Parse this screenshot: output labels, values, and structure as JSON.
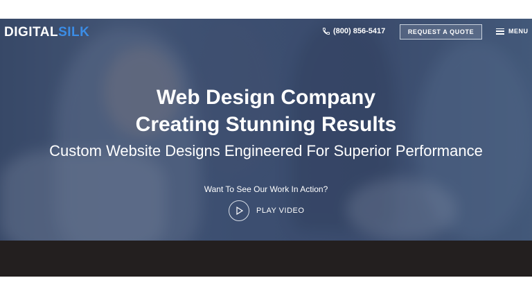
{
  "header": {
    "logo_part1": "DIGITAL",
    "logo_part2": "SILK",
    "phone": "(800) 856-5417",
    "quote_button": "REQUEST A QUOTE",
    "menu_label": "MENU"
  },
  "hero": {
    "title_line1": "Web Design Company",
    "title_line2": "Creating Stunning Results",
    "subtitle": "Custom Website Designs Engineered For Superior Performance",
    "prompt": "Want To See Our Work In Action?",
    "play_label": "PLAY VIDEO"
  },
  "colors": {
    "brand_accent": "#3b8de6",
    "overlay": "#22345c",
    "dark_band": "#231f1f"
  },
  "icons": [
    "phone-icon",
    "hamburger-menu-icon",
    "play-icon"
  ]
}
